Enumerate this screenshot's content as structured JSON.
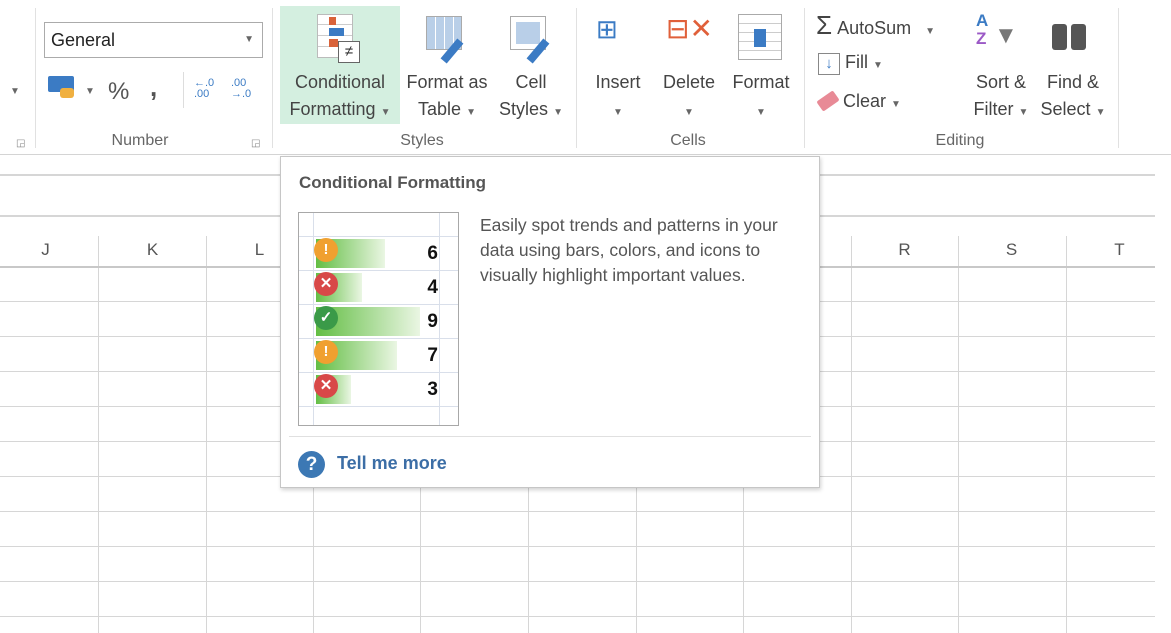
{
  "ribbon": {
    "number_group": {
      "label": "Number",
      "format_combo": "General",
      "percent": "%",
      "comma": ",",
      "increase_decimal": "←.0 .00",
      "decrease_decimal": ".00 →.0"
    },
    "styles_group": {
      "label": "Styles",
      "conditional_formatting": [
        "Conditional",
        "Formatting"
      ],
      "format_as_table": [
        "Format as",
        "Table"
      ],
      "cell_styles": [
        "Cell",
        "Styles"
      ]
    },
    "cells_group": {
      "label": "Cells",
      "insert": "Insert",
      "delete": "Delete",
      "format": "Format"
    },
    "editing_group": {
      "label": "Editing",
      "autosum": "AutoSum",
      "fill": "Fill",
      "clear": "Clear",
      "sort_filter": [
        "Sort &",
        "Filter"
      ],
      "find_select": [
        "Find &",
        "Select"
      ]
    }
  },
  "sheet": {
    "columns_left": [
      "J",
      "K",
      "L"
    ],
    "columns_right": [
      "R",
      "S",
      "T"
    ]
  },
  "tooltip": {
    "title": "Conditional Formatting",
    "description": "Easily spot trends and patterns in your data using bars, colors, and icons to visually highlight important values.",
    "preview_rows": [
      {
        "icon": "warning",
        "value": "6"
      },
      {
        "icon": "error",
        "value": "4"
      },
      {
        "icon": "check",
        "value": "9"
      },
      {
        "icon": "warning",
        "value": "7"
      },
      {
        "icon": "error",
        "value": "3"
      }
    ],
    "link": "Tell me more",
    "colors": {
      "warning": "#f0a030",
      "error": "#d84848",
      "check": "#3a9a48",
      "bar": "#63be44",
      "link": "#3c6ea6"
    }
  }
}
